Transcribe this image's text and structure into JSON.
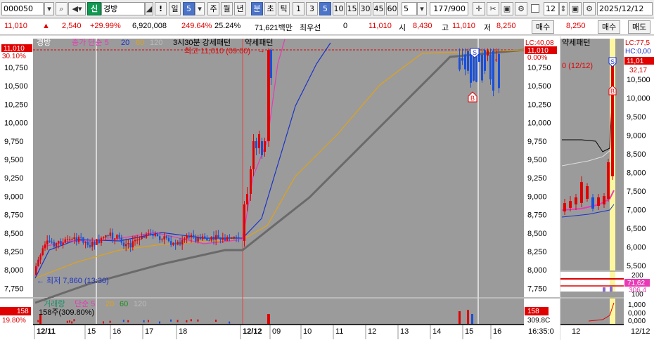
{
  "toolbar": {
    "code": "000050",
    "badge": "신",
    "name": "경방",
    "alert": "!",
    "period_day": "일",
    "period_num": "5",
    "tabs": [
      "주",
      "월",
      "년",
      "분",
      "초",
      "틱"
    ],
    "selected_tab": "분",
    "minutes": [
      "1",
      "3",
      "5",
      "10",
      "15",
      "30",
      "45",
      "60"
    ],
    "selected_minute": "5",
    "minute_input": "5",
    "count": "177/900",
    "side_input": "12",
    "date": "2025/12/12"
  },
  "quote": {
    "price": "11,010",
    "change": "2,540",
    "change_pct": "+29.99%",
    "volume": "6,920,008",
    "vol_ratio": "249.64%",
    "turnover": "25.24%",
    "amount": "71,621백만",
    "best_label": "최우선",
    "best_value": "0",
    "bid": "11,010",
    "open_label": "시",
    "open": "8,430",
    "high_label": "고",
    "high": "11,010",
    "low_label": "저",
    "low": "8,250",
    "side_price": "8,250",
    "buy": "매수",
    "sell": "매도"
  },
  "main_chart": {
    "legend_name": "경방",
    "legend_ma": "종가 단순 5",
    "legend_ma_20": "20",
    "legend_ma_60": "60",
    "legend_ma_120": "120",
    "pattern_1": "3시30분 강세패턴",
    "pattern_2": "약세패턴",
    "high_note": "최고 11,010 (09:00)",
    "low_note": "최저 7,860 (13:30)",
    "price_tag": "11,010",
    "price_tag_pct": "0.00%",
    "lc": "LC:40,08",
    "left_tag": "11,010",
    "left_tag_pct": "30.10%",
    "price_ticks": [
      "10,750",
      "10,500",
      "10,250",
      "10,000",
      "9,750",
      "9,500",
      "9,250",
      "9,000",
      "8,750",
      "8,500",
      "8,250",
      "8,000",
      "7,750"
    ],
    "vol_legend": "거래량",
    "vol_ma": "단순 5",
    "vol_ma_20": "20",
    "vol_ma_60": "60",
    "vol_ma_120": "120",
    "vol_value": "158주(309.80%)",
    "vol_tag": "158",
    "vol_tag_pct": "309.8C",
    "vol_left_tag": "158",
    "vol_left_pct": "19.80%",
    "time_labels": [
      "12/11",
      "15",
      "16",
      "17",
      "18",
      "12/12",
      "09",
      "10",
      "11",
      "12",
      "13",
      "14",
      "15",
      "16"
    ],
    "time_now": "16:35:0"
  },
  "side_chart": {
    "pattern": "약세패턴",
    "lc": "LC:77,5",
    "hc": "HC:0,00",
    "price_tag": "11,01",
    "price_tag_2": "32,17",
    "note": "0 (12/12)",
    "price_ticks": [
      "10,500",
      "10,000",
      "9,500",
      "9,000",
      "8,500",
      "8,000",
      "7,500",
      "7,000",
      "6,500",
      "6,000",
      "5,500"
    ],
    "ind_ticks": [
      "200",
      "100"
    ],
    "ind_tag_1": "71,62",
    "ind_tag_2": "306,4",
    "vol_ticks": [
      "1,000",
      "0,000",
      "0,000"
    ],
    "time_labels": [
      "12",
      "12/12"
    ]
  },
  "colors": {
    "up": "#e00000",
    "down": "#1a4fd6",
    "bg_chart": "#9b9b9b",
    "ma5": "#e83ab5",
    "ma20": "#1a33c8",
    "ma60": "#e0a21a",
    "ma120": "#6e6e6e"
  }
}
